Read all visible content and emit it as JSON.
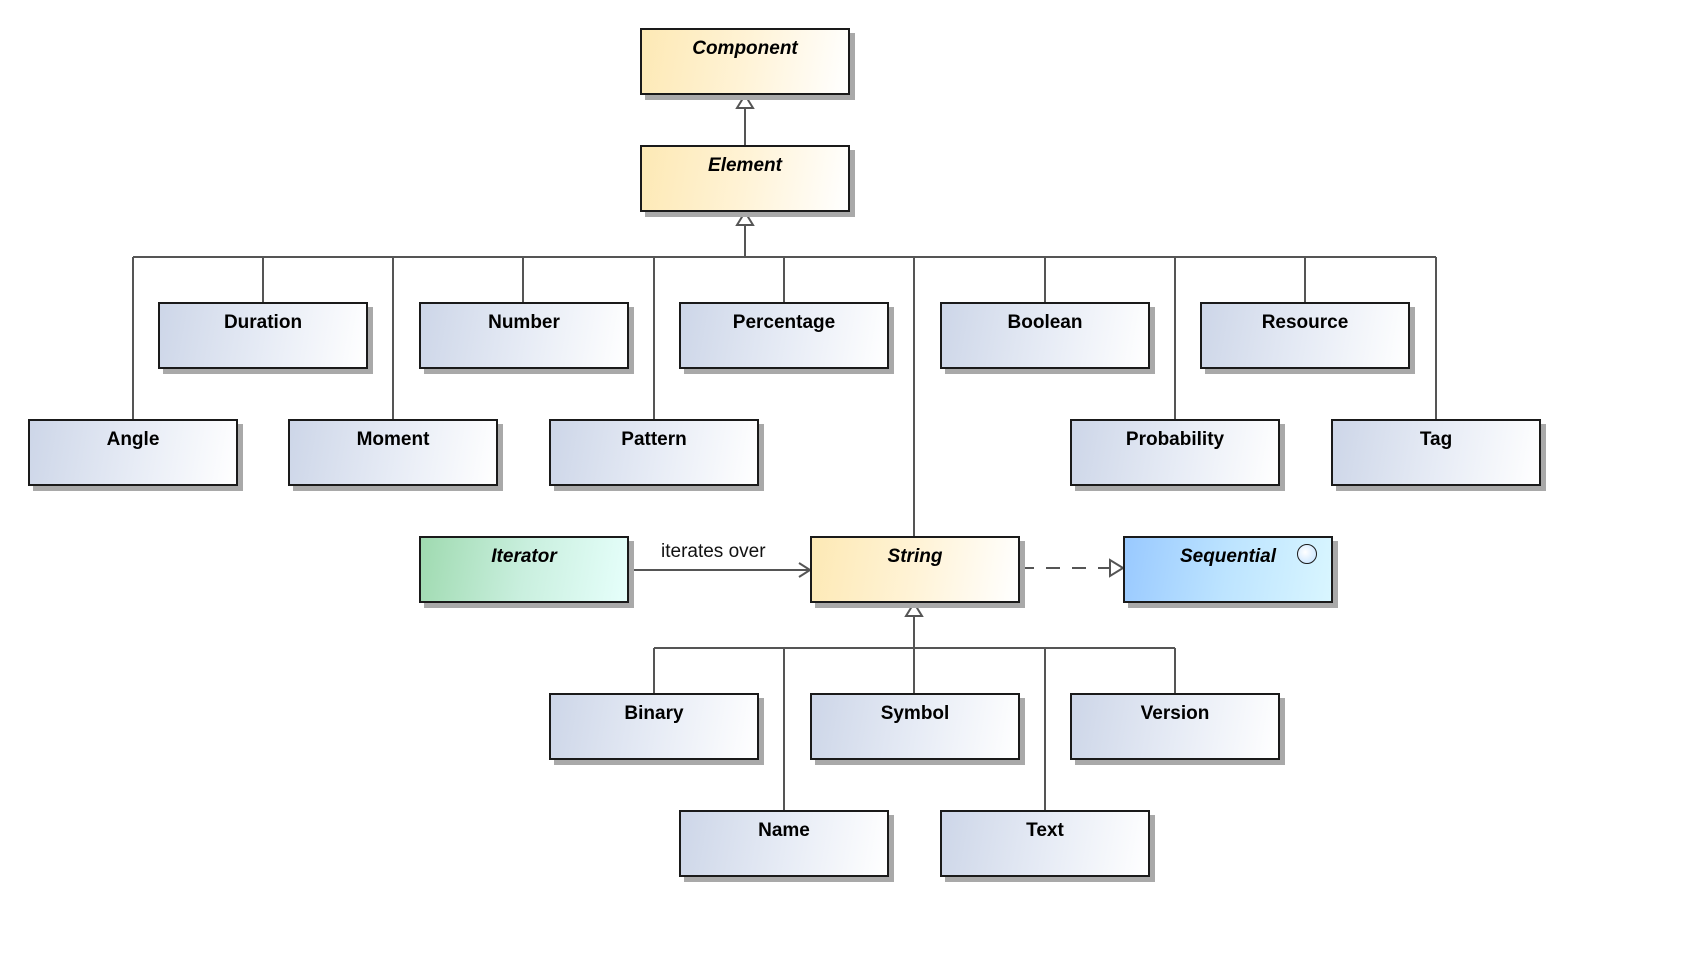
{
  "diagram": {
    "type": "UML class diagram",
    "classes": {
      "component": {
        "name": "Component",
        "kind": "abstract"
      },
      "element": {
        "name": "Element",
        "kind": "abstract"
      },
      "angle": {
        "name": "Angle",
        "kind": "class"
      },
      "duration": {
        "name": "Duration",
        "kind": "class"
      },
      "moment": {
        "name": "Moment",
        "kind": "class"
      },
      "number": {
        "name": "Number",
        "kind": "class"
      },
      "pattern": {
        "name": "Pattern",
        "kind": "class"
      },
      "percentage": {
        "name": "Percentage",
        "kind": "class"
      },
      "boolean": {
        "name": "Boolean",
        "kind": "class"
      },
      "probability": {
        "name": "Probability",
        "kind": "class"
      },
      "resource": {
        "name": "Resource",
        "kind": "class"
      },
      "tag": {
        "name": "Tag",
        "kind": "class"
      },
      "iterator": {
        "name": "Iterator",
        "kind": "abstract"
      },
      "string": {
        "name": "String",
        "kind": "abstract"
      },
      "sequential": {
        "name": "Sequential",
        "kind": "interface",
        "icon": "interface-circle-icon"
      },
      "binary": {
        "name": "Binary",
        "kind": "class"
      },
      "name": {
        "name": "Name",
        "kind": "class"
      },
      "symbol": {
        "name": "Symbol",
        "kind": "class"
      },
      "text": {
        "name": "Text",
        "kind": "class"
      },
      "version": {
        "name": "Version",
        "kind": "class"
      }
    },
    "relations": [
      {
        "type": "generalization",
        "from": "Element",
        "to": "Component"
      },
      {
        "type": "generalization",
        "from": "Angle",
        "to": "Element"
      },
      {
        "type": "generalization",
        "from": "Duration",
        "to": "Element"
      },
      {
        "type": "generalization",
        "from": "Moment",
        "to": "Element"
      },
      {
        "type": "generalization",
        "from": "Number",
        "to": "Element"
      },
      {
        "type": "generalization",
        "from": "Pattern",
        "to": "Element"
      },
      {
        "type": "generalization",
        "from": "Percentage",
        "to": "Element"
      },
      {
        "type": "generalization",
        "from": "String",
        "to": "Element"
      },
      {
        "type": "generalization",
        "from": "Boolean",
        "to": "Element"
      },
      {
        "type": "generalization",
        "from": "Probability",
        "to": "Element"
      },
      {
        "type": "generalization",
        "from": "Resource",
        "to": "Element"
      },
      {
        "type": "generalization",
        "from": "Tag",
        "to": "Element"
      },
      {
        "type": "association",
        "from": "Iterator",
        "to": "String",
        "label": "iterates over"
      },
      {
        "type": "realization",
        "from": "String",
        "to": "Sequential"
      },
      {
        "type": "generalization",
        "from": "Binary",
        "to": "String"
      },
      {
        "type": "generalization",
        "from": "Name",
        "to": "String"
      },
      {
        "type": "generalization",
        "from": "Symbol",
        "to": "String"
      },
      {
        "type": "generalization",
        "from": "Text",
        "to": "String"
      },
      {
        "type": "generalization",
        "from": "Version",
        "to": "String"
      }
    ],
    "association_label": "iterates over",
    "colors": {
      "class_fill": "#cdd6e8",
      "abstract_fill": "#fde9b5",
      "iterator_fill": "#9fdab0",
      "interface_fill": "#99c9ff",
      "line": "#555555",
      "shadow": "#a9a9a9"
    }
  }
}
